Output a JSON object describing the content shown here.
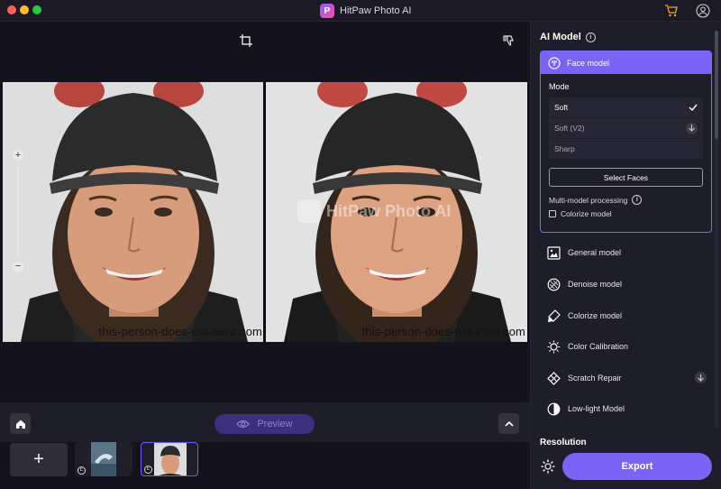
{
  "window": {
    "title": "HitPaw Photo AI"
  },
  "canvas": {
    "watermark_left": "this-person-does-not-exist.com",
    "watermark_right": "this-person-does-not-exist.com",
    "app_watermark": "HitPaw Photo AI",
    "zoom_in": "+",
    "zoom_out": "−"
  },
  "bottom": {
    "preview_label": "Preview",
    "add_label": "+"
  },
  "panel": {
    "title": "AI Model",
    "face_model": {
      "label": "Face model",
      "mode_label": "Mode",
      "modes": [
        {
          "label": "Soft",
          "state": "selected"
        },
        {
          "label": "Soft (V2)",
          "state": "download"
        },
        {
          "label": "Sharp",
          "state": ""
        }
      ],
      "select_faces": "Select Faces",
      "multi_model": "Multi-model processing",
      "colorize_model": "Colorize model"
    },
    "models": [
      {
        "label": "General model",
        "icon": "general-model-icon"
      },
      {
        "label": "Denoise model",
        "icon": "denoise-icon"
      },
      {
        "label": "Colorize model",
        "icon": "colorize-icon"
      },
      {
        "label": "Color Calibration",
        "icon": "color-calibration-icon"
      },
      {
        "label": "Scratch Repair",
        "icon": "scratch-repair-icon",
        "download": true
      },
      {
        "label": "Low-light Model",
        "icon": "low-light-icon"
      }
    ],
    "resolution_label": "Resolution",
    "export_label": "Export"
  },
  "colors": {
    "accent": "#7b63f5",
    "background": "#14131d",
    "panel": "#1e1d2a"
  }
}
